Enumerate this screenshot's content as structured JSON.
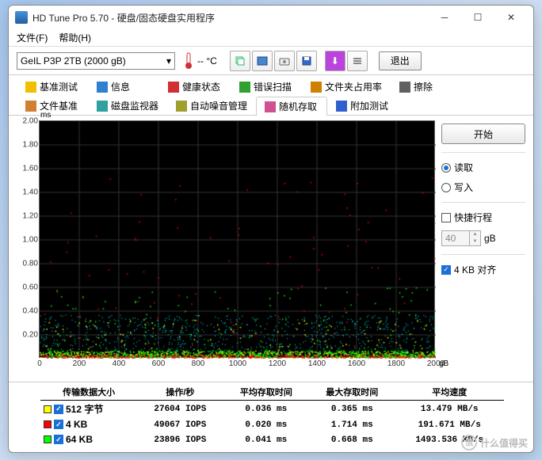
{
  "window": {
    "title": "HD Tune Pro 5.70 - 硬盘/固态硬盘实用程序"
  },
  "menubar": {
    "file": "文件(F)",
    "help": "帮助(H)"
  },
  "toolbar": {
    "drive": "GeIL P3P 2TB (2000 gB)",
    "temp": "-- °C",
    "exit": "退出"
  },
  "tabs": {
    "row1": [
      "基准测试",
      "信息",
      "健康状态",
      "错误扫描",
      "文件夹占用率",
      "擦除"
    ],
    "row2": [
      "文件基准",
      "磁盘监视器",
      "自动噪音管理",
      "随机存取",
      "附加测试"
    ],
    "active": "随机存取"
  },
  "chart_data": {
    "type": "scatter",
    "xlabel": "gB",
    "ylabel": "ms",
    "xlim": [
      0,
      2000
    ],
    "ylim": [
      0,
      2.0
    ],
    "xticks": [
      0,
      200,
      400,
      600,
      800,
      1000,
      1200,
      1400,
      1600,
      1800,
      2000
    ],
    "yticks": [
      0.2,
      0.4,
      0.6,
      0.8,
      1.0,
      1.2,
      1.4,
      1.6,
      1.8,
      2.0
    ],
    "series": [
      {
        "name": "512 字节",
        "color": "#ffff00",
        "avg_ms": 0.036,
        "max_ms": 0.365
      },
      {
        "name": "4 KB",
        "color": "#ff0000",
        "avg_ms": 0.02,
        "max_ms": 1.714
      },
      {
        "name": "64 KB",
        "color": "#00ff00",
        "avg_ms": 0.041,
        "max_ms": 0.668
      }
    ]
  },
  "side": {
    "start": "开始",
    "read": "读取",
    "write": "写入",
    "quick": "快捷行程",
    "size_value": "40",
    "size_unit": "gB",
    "align": "4 KB 对齐"
  },
  "results": {
    "headers": [
      "传输数据大小",
      "操作/秒",
      "平均存取时间",
      "最大存取时间",
      "平均速度"
    ],
    "rows": [
      {
        "color": "#ffff00",
        "label": "512 字节",
        "iops": "27604 IOPS",
        "avg": "0.036 ms",
        "max": "0.365 ms",
        "speed": "13.479 MB/s"
      },
      {
        "color": "#ff0000",
        "label": "4 KB",
        "iops": "49067 IOPS",
        "avg": "0.020 ms",
        "max": "1.714 ms",
        "speed": "191.671 MB/s"
      },
      {
        "color": "#00ff00",
        "label": "64 KB",
        "iops": "23896 IOPS",
        "avg": "0.041 ms",
        "max": "0.668 ms",
        "speed": "1493.536 MB/s"
      }
    ]
  },
  "watermark": "什么值得买"
}
